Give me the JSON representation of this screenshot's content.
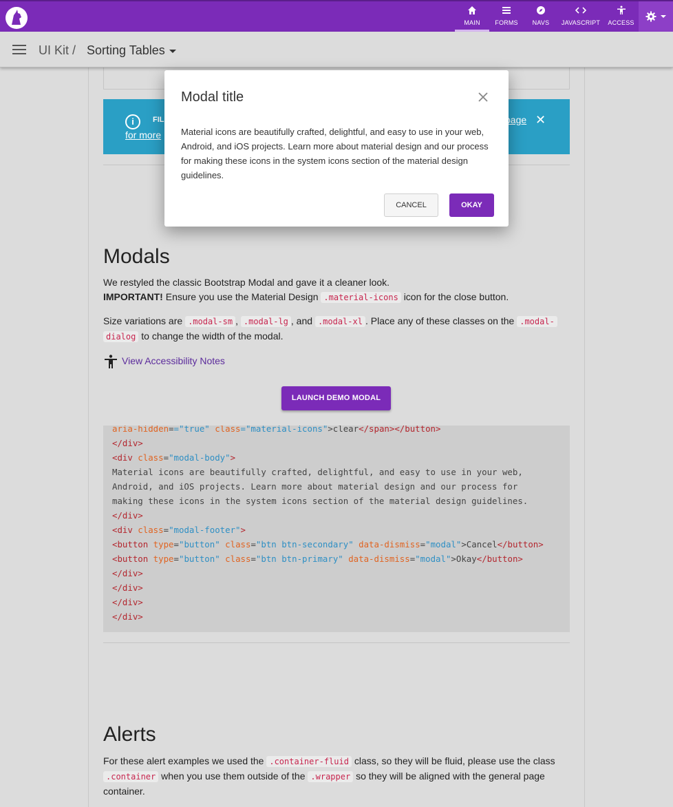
{
  "topnav": {
    "items": [
      {
        "label": "MAIN",
        "icon": "home-icon"
      },
      {
        "label": "FORMS",
        "icon": "list-icon"
      },
      {
        "label": "NAVS",
        "icon": "compass-icon"
      },
      {
        "label": "JAVASCRIPT",
        "icon": "code-icon"
      },
      {
        "label": "ACCESS",
        "icon": "accessibility-icon"
      }
    ],
    "accent": "#7b2bb8"
  },
  "breadcrumb": {
    "parent": "UI Kit /",
    "current": "Sorting Tables"
  },
  "alert": {
    "label": "FIL",
    "more": "for more",
    "link": "page",
    "close": "✕"
  },
  "modal": {
    "title": "Modal title",
    "body": "Material icons are beautifully crafted, delightful, and easy to use in your web, Android, and iOS projects. Learn more about material design and our process for making these icons in the system icons section of the material design guidelines.",
    "cancel": "CANCEL",
    "okay": "OKAY"
  },
  "modals_section": {
    "heading": "Modals",
    "p1": "We restyled the classic Bootstrap Modal and gave it a cleaner look.",
    "important": "IMPORTANT!",
    "p2a": "Ensure you use the Material Design",
    "p2code": ".material-icons",
    "p2b": "icon for the close button.",
    "p3a": "Size variations are",
    "sm": ".modal-sm",
    "lg": ".modal-lg",
    "and": ", and",
    "xl": ".modal-xl",
    "p3b": ". Place any of these classes on the",
    "dialog1": ".modal-",
    "dialog2": "dialog",
    "p3c": "to change the width of the modal.",
    "a11y": "View Accessibility Notes",
    "launch": "LAUNCH DEMO MODAL"
  },
  "code": {
    "l0a": "aria-hidden",
    "l0b": "=\"true\"",
    "l0c": " class",
    "l0d": "=\"material-icons\"",
    "l0e": ">clear",
    "l0f": "</span></button>",
    "close_div": "</div>",
    "div_open": "<div",
    "class_attr": " class",
    "eq": "=",
    "body_cls": "\"modal-body\"",
    "footer_cls": "\"modal-footer\"",
    "gt": ">",
    "text1": "Material icons are beautifully crafted, delightful, and easy to use in your web,",
    "text2": "Android, and iOS projects. Learn more about material design and our process for",
    "text3": "making these icons in the system icons section of the material design guidelines.",
    "btn_open": "<button",
    "type_attr": " type",
    "btn_type": "\"button\"",
    "btn_sec": "\"btn btn-secondary\"",
    "btn_pri": "\"btn btn-primary\"",
    "dismiss_attr": " data-dismiss",
    "dismiss_val": "\"modal\"",
    "cancel_txt": ">Cancel",
    "okay_txt": ">Okay",
    "btn_close": "</button>"
  },
  "alerts_section": {
    "heading": "Alerts",
    "p1a": "For these alert examples we used the",
    "fluid": ".container-fluid",
    "p1b": "class, so they will be fluid, please use the class",
    "container": ".container",
    "p1c": "when you use them outside of the",
    "wrapper": ".wrapper",
    "p1d": "so they will be aligned with the general page",
    "p1e": "container."
  }
}
